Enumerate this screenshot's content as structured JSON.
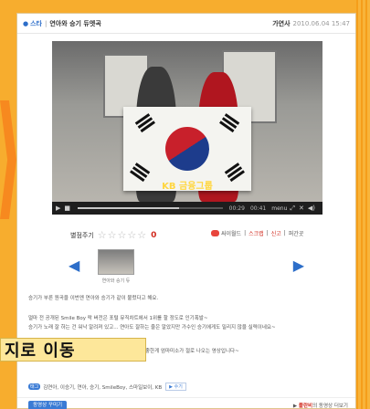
{
  "header": {
    "bullet": "●",
    "category": "스타",
    "separator": "|",
    "title": "연아와 승기 듀엣곡",
    "author": "가연사",
    "datetime": "2010.06.04 15:47"
  },
  "player": {
    "logo_text": "KB 금융그룹",
    "time_current": "00:29",
    "time_total": "00:41",
    "menu_label": "menu",
    "progress": 0.7,
    "controls": {
      "play": "▶",
      "stop": "■",
      "fullscreen": "⤢",
      "close": "✕",
      "volume": "◀)"
    }
  },
  "rating": {
    "label": "별점주기",
    "stars": "☆☆☆☆☆",
    "count": "0"
  },
  "share": {
    "links": [
      "싸이월드",
      "스크랩",
      "신고",
      "퍼간곳"
    ],
    "separator": "|"
  },
  "thumbnails": {
    "prev_arrow": "◀",
    "next_arrow": "▶",
    "caption": "연아와 승기 듀"
  },
  "body": {
    "line1": "승기가 부른 원곡을 이번엔 연아와 승기가 같이 불렀다고 해요.",
    "line2": "얼마 전 공개된 Smile Boy 락 버전은 포털 뮤직차트에서 1위를 할 정도로 인기폭발~",
    "line3": "승기가 노래 잘 하는 건 워낙 알려져 있고... 연아도 잘하는 줄은 알았지만 가수인 승기에게도 밀리지 않을 실력이네요~",
    "line4": "좋한게 엄마미소가 절로 나오는 영상입니다~"
  },
  "tags": {
    "badge": "태그",
    "list": "김연아, 이승기, 연아, 승기, SmileBoy, 스마일보이, KB",
    "more": "▶ 수기"
  },
  "footer": {
    "edit_button": "동영상 꾸미기",
    "more_prefix": "▶ ",
    "more_highlight": "플란비",
    "more_suffix": "의 동영상 더보기"
  },
  "overlay": {
    "text": "지로 이동"
  },
  "colors": {
    "background": "#f7ad2e",
    "accent_blue": "#2d6ec9",
    "accent_red": "#d12a1e"
  }
}
